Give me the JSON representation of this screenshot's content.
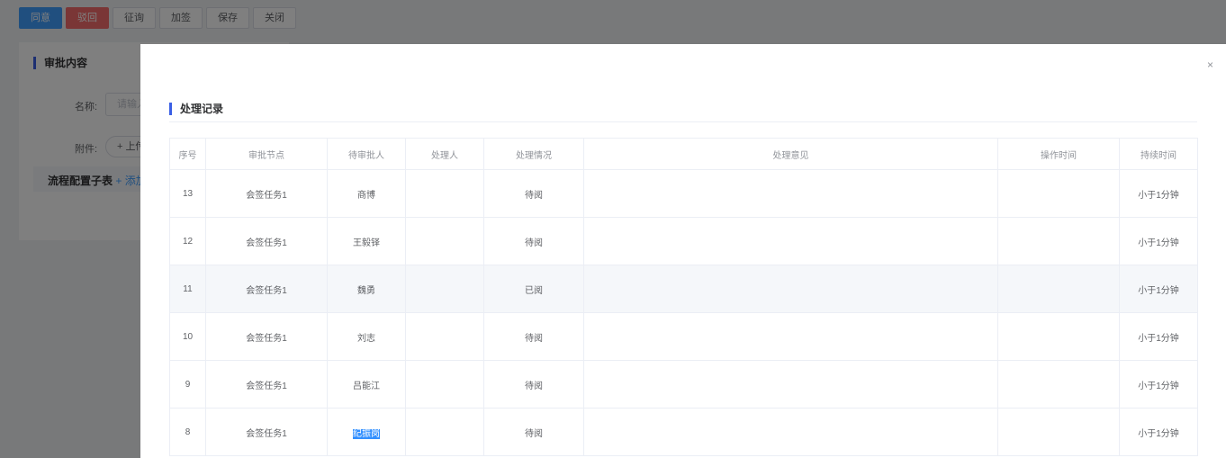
{
  "toolbar": {
    "agree": "同意",
    "reject": "驳回",
    "consult": "征询",
    "add_sign": "加签",
    "save": "保存",
    "close": "关闭"
  },
  "background_form": {
    "section_title": "审批内容",
    "name_label": "名称:",
    "name_placeholder": "请输入",
    "attachment_label": "附件:",
    "upload_label": "+ 上传",
    "subtable_title": "流程配置子表",
    "subtable_add": "+ 添加"
  },
  "dialog": {
    "close_icon": "×",
    "section_title": "处理记录",
    "columns": [
      "序号",
      "审批节点",
      "待审批人",
      "处理人",
      "处理情况",
      "处理意见",
      "操作时间",
      "持续时间"
    ],
    "rows": [
      [
        "13",
        "会签任务1",
        "商博",
        "",
        "待阅",
        "",
        "",
        "小于1分钟"
      ],
      [
        "12",
        "会签任务1",
        "王毅铎",
        "",
        "待阅",
        "",
        "",
        "小于1分钟"
      ],
      [
        "11",
        "会签任务1",
        "魏勇",
        "",
        "已阅",
        "",
        "",
        "小于1分钟"
      ],
      [
        "10",
        "会签任务1",
        "刘志",
        "",
        "待阅",
        "",
        "",
        "小于1分钟"
      ],
      [
        "9",
        "会签任务1",
        "吕能江",
        "",
        "待阅",
        "",
        "",
        "小于1分钟"
      ],
      [
        "8",
        "会签任务1",
        "纪振岗",
        "",
        "待阅",
        "",
        "",
        "小于1分钟"
      ]
    ]
  },
  "colors": {
    "primary": "#409eff",
    "danger": "#f56c6c",
    "accent": "#3a5fe5"
  }
}
